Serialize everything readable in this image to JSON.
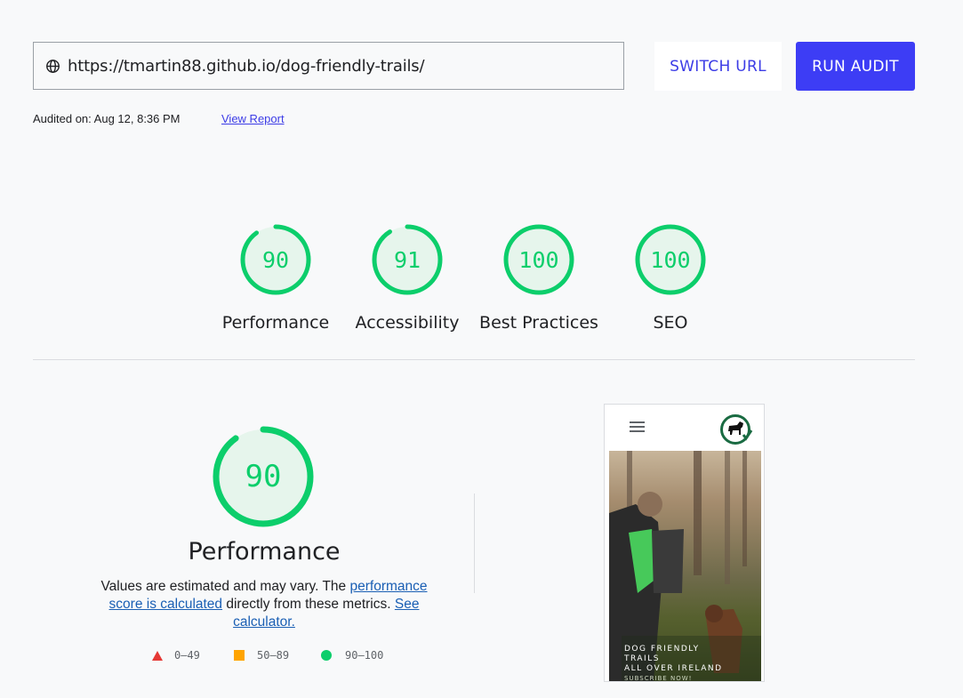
{
  "url_bar": {
    "value": "https://tmartin88.github.io/dog-friendly-trails/",
    "icon": "globe-icon"
  },
  "buttons": {
    "switch_url": "SWITCH URL",
    "run_audit": "RUN AUDIT"
  },
  "audit_meta": {
    "audited_on": "Audited on: Aug 12, 8:36 PM",
    "view_report": "View Report"
  },
  "categories": [
    {
      "label": "Performance",
      "score": "90",
      "value": 90
    },
    {
      "label": "Accessibility",
      "score": "91",
      "value": 91
    },
    {
      "label": "Best Practices",
      "score": "100",
      "value": 100
    },
    {
      "label": "SEO",
      "score": "100",
      "value": 100
    }
  ],
  "performance": {
    "score": "90",
    "value": 90,
    "title": "Performance",
    "desc_1": "Values are estimated and may vary. The ",
    "link_1": "performance score is calculated",
    "desc_2": " directly from these metrics. ",
    "link_2": "See calculator."
  },
  "legend": [
    {
      "range": "0–49",
      "shape": "triangle",
      "color": "#e53935"
    },
    {
      "range": "50–89",
      "shape": "square",
      "color": "#ffa400"
    },
    {
      "range": "90–100",
      "shape": "circle",
      "color": "#0cce6b"
    }
  ],
  "colors": {
    "pass": "#0cce6b",
    "pass_bg": "#e6f5ec",
    "accent": "#3d3df5",
    "link": "#1a5fb4"
  },
  "screenshot": {
    "hero_line_1": "DOG FRIENDLY",
    "hero_line_2": "TRAILS",
    "hero_line_3": "ALL OVER IRELAND",
    "hero_sub": "SUBSCRIBE NOW!"
  }
}
